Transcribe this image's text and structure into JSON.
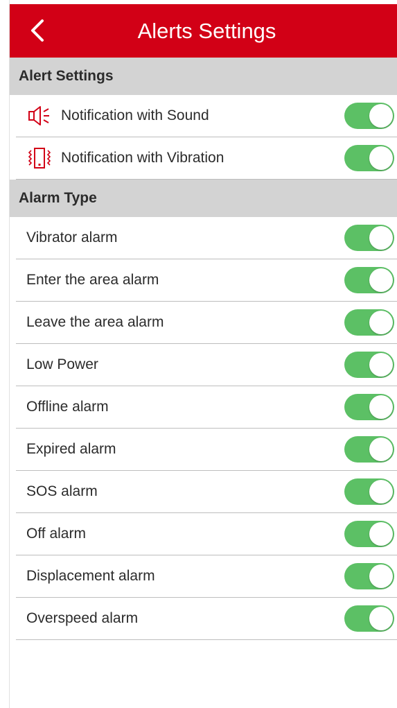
{
  "header": {
    "title": "Alerts Settings",
    "back_icon": "chevron-left-icon",
    "background": "#d20016"
  },
  "alert_settings": {
    "title": "Alert Settings",
    "items": [
      {
        "label": "Notification with Sound",
        "icon": "speaker-icon",
        "enabled": true
      },
      {
        "label": "Notification with Vibration",
        "icon": "vibration-icon",
        "enabled": true
      }
    ]
  },
  "alarm_type": {
    "title": "Alarm Type",
    "items": [
      {
        "label": "Vibrator alarm",
        "enabled": true
      },
      {
        "label": "Enter the area alarm",
        "enabled": true
      },
      {
        "label": "Leave the area alarm",
        "enabled": true
      },
      {
        "label": "Low Power",
        "enabled": true
      },
      {
        "label": "Offline alarm",
        "enabled": true
      },
      {
        "label": "Expired alarm",
        "enabled": true
      },
      {
        "label": "SOS alarm",
        "enabled": true
      },
      {
        "label": "Off alarm",
        "enabled": true
      },
      {
        "label": "Displacement alarm",
        "enabled": true
      },
      {
        "label": "Overspeed alarm",
        "enabled": true
      }
    ]
  },
  "colors": {
    "accent": "#d20016",
    "toggle_on": "#5cc065",
    "section_bg": "#d3d3d3"
  }
}
